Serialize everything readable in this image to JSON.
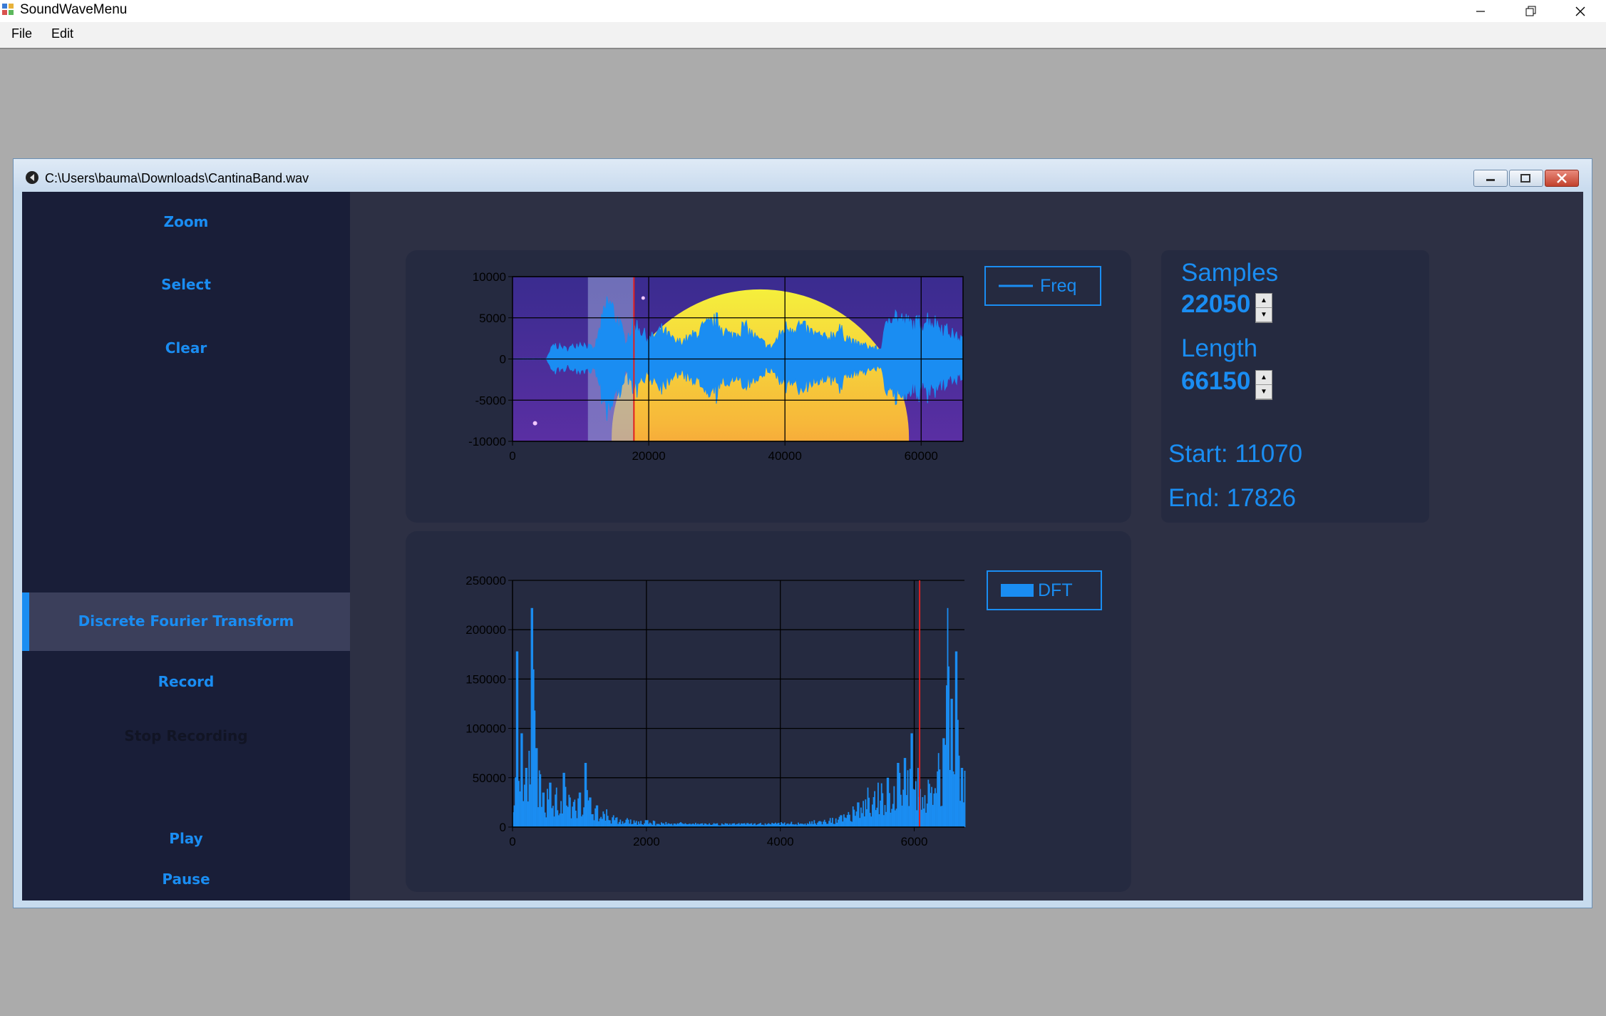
{
  "app": {
    "title": "SoundWaveMenu"
  },
  "menu": {
    "file": "File",
    "edit": "Edit"
  },
  "child_window": {
    "caption": "C:\\Users\\bauma\\Downloads\\CantinaBand.wav"
  },
  "sidebar": {
    "zoom": "Zoom",
    "select": "Select",
    "clear": "Clear",
    "dft": "Discrete Fourier Transform",
    "record": "Record",
    "stop_recording": "Stop Recording",
    "play": "Play",
    "pause": "Pause"
  },
  "info": {
    "samples_label": "Samples",
    "samples_value": "22050",
    "length_label": "Length",
    "length_value": "66150",
    "start": "Start: 11070",
    "end": "End: 17826"
  },
  "colors": {
    "accent": "#1a8df2",
    "selection": "#9aa8d8",
    "marker": "#e02020"
  },
  "chart_data": [
    {
      "type": "area",
      "name": "waveform",
      "legend": "Freq",
      "xlim": [
        0,
        66150
      ],
      "ylim": [
        -10000,
        10000
      ],
      "xticks": [
        "0",
        "20000",
        "40000",
        "60000"
      ],
      "xtick_values": [
        0,
        20000,
        40000,
        60000
      ],
      "yticks": [
        "10000",
        "5000",
        "0",
        "-5000",
        "-10000"
      ],
      "ytick_values": [
        10000,
        5000,
        0,
        -5000,
        -10000
      ],
      "selection": [
        11070,
        17826
      ],
      "envelope": [
        [
          0,
          30
        ],
        [
          5000,
          40
        ],
        [
          6000,
          2200
        ],
        [
          8000,
          1500
        ],
        [
          10000,
          2500
        ],
        [
          12000,
          1500
        ],
        [
          14000,
          9000
        ],
        [
          15500,
          6000
        ],
        [
          16500,
          3000
        ],
        [
          18000,
          5500
        ],
        [
          20000,
          3000
        ],
        [
          22000,
          4500
        ],
        [
          24000,
          2500
        ],
        [
          26000,
          3200
        ],
        [
          28000,
          4800
        ],
        [
          30000,
          5800
        ],
        [
          32000,
          3500
        ],
        [
          34000,
          5000
        ],
        [
          36000,
          3000
        ],
        [
          38000,
          1800
        ],
        [
          40000,
          4800
        ],
        [
          42000,
          5200
        ],
        [
          44000,
          4000
        ],
        [
          46000,
          3200
        ],
        [
          48000,
          4500
        ],
        [
          50000,
          2500
        ],
        [
          52000,
          2000
        ],
        [
          54000,
          1500
        ],
        [
          55500,
          7500
        ],
        [
          57000,
          6000
        ],
        [
          59000,
          5200
        ],
        [
          61000,
          6200
        ],
        [
          63000,
          5000
        ],
        [
          65000,
          3500
        ],
        [
          66150,
          3000
        ]
      ]
    },
    {
      "type": "bar",
      "name": "dft",
      "legend": "DFT",
      "xlim": [
        0,
        6750
      ],
      "ylim": [
        0,
        250000
      ],
      "xticks": [
        "0",
        "2000",
        "4000",
        "6000"
      ],
      "xtick_values": [
        0,
        2000,
        4000,
        6000
      ],
      "yticks": [
        "250000",
        "200000",
        "150000",
        "100000",
        "50000",
        "0"
      ],
      "ytick_values": [
        250000,
        200000,
        150000,
        100000,
        50000,
        0
      ],
      "marker_x": 6080,
      "peaks": [
        [
          60,
          178000
        ],
        [
          130,
          95000
        ],
        [
          200,
          60000
        ],
        [
          280,
          222000
        ],
        [
          350,
          80000
        ],
        [
          450,
          35000
        ],
        [
          550,
          45000
        ],
        [
          650,
          40000
        ],
        [
          760,
          55000
        ],
        [
          850,
          30000
        ],
        [
          1000,
          35000
        ],
        [
          1080,
          65000
        ],
        [
          1150,
          30000
        ],
        [
          1250,
          22000
        ],
        [
          1400,
          18000
        ],
        [
          1500,
          12000
        ],
        [
          1700,
          9000
        ],
        [
          2000,
          7000
        ],
        [
          2500,
          5000
        ],
        [
          3000,
          4000
        ],
        [
          3500,
          4000
        ],
        [
          4000,
          5000
        ],
        [
          4500,
          7000
        ],
        [
          4900,
          12000
        ],
        [
          5150,
          25000
        ],
        [
          5300,
          40000
        ],
        [
          5450,
          45000
        ],
        [
          5600,
          50000
        ],
        [
          5750,
          65000
        ],
        [
          5850,
          70000
        ],
        [
          5950,
          95000
        ],
        [
          6050,
          60000
        ],
        [
          6200,
          48000
        ],
        [
          6350,
          75000
        ],
        [
          6430,
          90000
        ],
        [
          6490,
          222000
        ],
        [
          6550,
          130000
        ],
        [
          6620,
          178000
        ],
        [
          6700,
          60000
        ]
      ]
    }
  ]
}
